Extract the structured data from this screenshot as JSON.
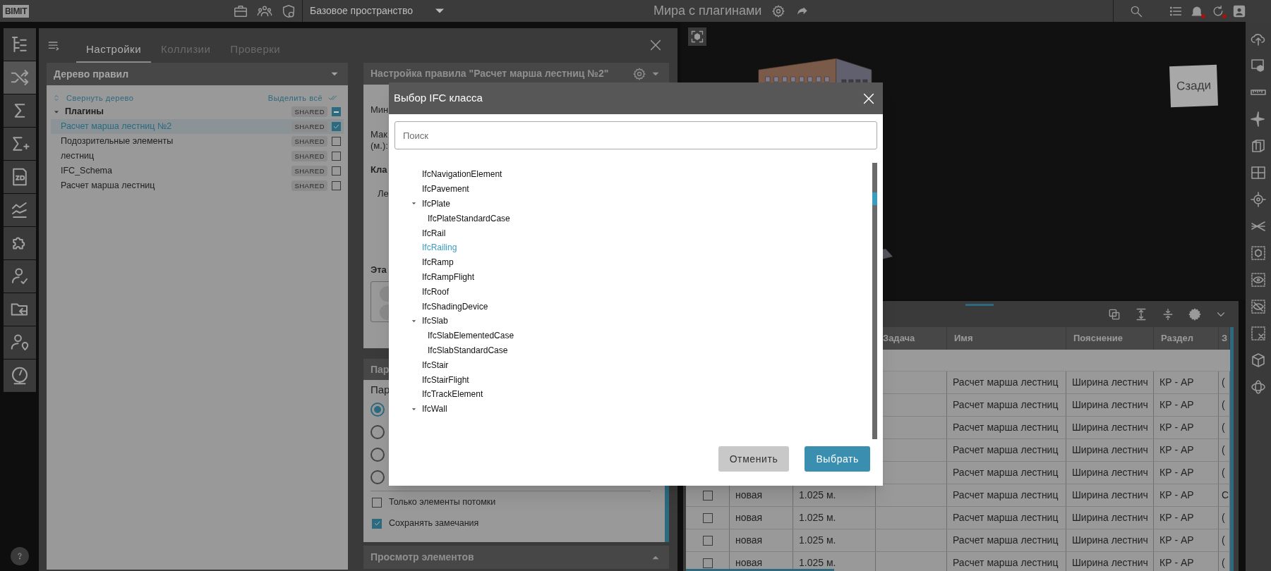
{
  "top_bar": {
    "logo": "BIMIT",
    "workspace": "Базовое пространство",
    "project_title": "Мира с плагинами",
    "notifications_unread": true,
    "history_unread": true
  },
  "settings_panel": {
    "tabs": [
      {
        "label": "Настройки",
        "selected": true
      },
      {
        "label": "Коллизии",
        "selected": false
      },
      {
        "label": "Проверки",
        "selected": false
      }
    ],
    "rule_tree": {
      "title": "Дерево правил",
      "collapse_label": "Свернуть дерево",
      "select_all_label": "Выделить всё",
      "items": [
        {
          "label": "Плагины",
          "badge": "SHARED",
          "indeterminate": true,
          "selected": false,
          "expanded": true,
          "children": [
            {
              "label": "Расчет марша лестниц №2",
              "badge": "SHARED",
              "checked": true,
              "selected": true
            },
            {
              "label": "Подозрительные элементы",
              "badge": "SHARED",
              "checked": false,
              "selected": false
            },
            {
              "label": "лестниц",
              "badge": "SHARED",
              "checked": false,
              "selected": false
            },
            {
              "label": "IFC_Schema",
              "badge": "SHARED",
              "checked": false,
              "selected": false
            },
            {
              "label": "Расчет марша лестниц",
              "badge": "SHARED",
              "checked": false,
              "selected": false
            }
          ]
        }
      ]
    },
    "rule_settings": {
      "title": "Настройка правила \"Расчет марша лестниц №2\"",
      "labels": [
        {
          "text": "Мин",
          "bold": false
        },
        {
          "text": "Мак",
          "bold": false
        },
        {
          "text": "(м.):",
          "bold": false
        },
        {
          "text": "Кла",
          "bold": true
        },
        {
          "text": "Ле",
          "bold": false
        }
      ],
      "floor_label": "Эта"
    },
    "parameters": {
      "title": "Пар",
      "subtitle": "Пар",
      "radios": [
        {
          "selected": true
        },
        {
          "selected": false
        },
        {
          "selected": false
        },
        {
          "selected": false
        }
      ],
      "options": [
        {
          "label": "Только элементы потомки",
          "checked": false
        },
        {
          "label": "Сохранять замечания",
          "checked": true
        }
      ]
    },
    "preview_title": "Просмотр элементов"
  },
  "viewer": {
    "view_cube_label": "Сзади"
  },
  "results_table": {
    "columns": [
      "Задача",
      "Имя",
      "Пояснение",
      "Раздел",
      "З"
    ],
    "rows": [
      {
        "name": "Расчет марша лестниц",
        "note": "Ширина лестнич",
        "section": "КР - АР",
        "column_8": "("
      },
      {
        "name": "Расчет марша лестниц",
        "note": "Ширина лестнич",
        "section": "КР - АР",
        "column_8": "("
      },
      {
        "name": "Расчет марша лестниц",
        "note": "Ширина лестнич",
        "section": "КР - АР",
        "column_8": "("
      },
      {
        "name": "Расчет марша лестниц",
        "note": "Ширина лестнич",
        "section": "КР - АР",
        "column_8": "("
      },
      {
        "name": "Расчет марша лестниц",
        "note": "Ширина лестнич",
        "section": "КР - АР",
        "column_8": "("
      },
      {
        "status": "новая",
        "value": "1.025 м.",
        "name": "Расчет марша лестниц",
        "note": "Ширина лестнич",
        "section": "КР - АР",
        "column_8": "С",
        "checked": false
      },
      {
        "status": "новая",
        "value": "1.025 м.",
        "name": "Расчет марша лестниц",
        "note": "Ширина лестнич",
        "section": "КР - АР",
        "column_8": "(",
        "checked": false
      },
      {
        "status": "новая",
        "value": "1.025 м.",
        "name": "Расчет марша лестниц",
        "note": "Ширина лестнич",
        "section": "КР - АР",
        "column_8": "(",
        "checked": false
      },
      {
        "status": "новая",
        "value": "1.025 м.",
        "name": "Расчет марша лестниц",
        "note": "Ширина лестнич",
        "section": "КР - АР",
        "column_8": "(",
        "checked": false
      }
    ]
  },
  "dialog": {
    "title": "Выбор IFC класса",
    "search_placeholder": "Поиск",
    "items": [
      {
        "label": "IfcNavigationElement",
        "kind": "leaf",
        "selected": false
      },
      {
        "label": "IfcPavement",
        "kind": "leaf",
        "selected": false
      },
      {
        "label": "IfcPlate",
        "kind": "group",
        "expanded": true,
        "selected": false,
        "children": [
          {
            "label": "IfcPlateStandardCase",
            "kind": "leaf",
            "selected": false
          }
        ]
      },
      {
        "label": "IfcRail",
        "kind": "leaf",
        "selected": false
      },
      {
        "label": "IfcRailing",
        "kind": "leaf",
        "selected": true
      },
      {
        "label": "IfcRamp",
        "kind": "leaf",
        "selected": false
      },
      {
        "label": "IfcRampFlight",
        "kind": "leaf",
        "selected": false
      },
      {
        "label": "IfcRoof",
        "kind": "leaf",
        "selected": false
      },
      {
        "label": "IfcShadingDevice",
        "kind": "leaf",
        "selected": false
      },
      {
        "label": "IfcSlab",
        "kind": "group",
        "expanded": true,
        "selected": false,
        "children": [
          {
            "label": "IfcSlabElementedCase",
            "kind": "leaf",
            "selected": false
          },
          {
            "label": "IfcSlabStandardCase",
            "kind": "leaf",
            "selected": false
          }
        ]
      },
      {
        "label": "IfcStair",
        "kind": "leaf",
        "selected": false
      },
      {
        "label": "IfcStairFlight",
        "kind": "leaf",
        "selected": false
      },
      {
        "label": "IfcTrackElement",
        "kind": "leaf",
        "selected": false
      },
      {
        "label": "IfcWall",
        "kind": "group",
        "expanded": true,
        "selected": false
      }
    ],
    "buttons": [
      {
        "label": "Отменить",
        "kind": "secondary"
      },
      {
        "label": "Выбрать",
        "kind": "primary"
      }
    ]
  }
}
